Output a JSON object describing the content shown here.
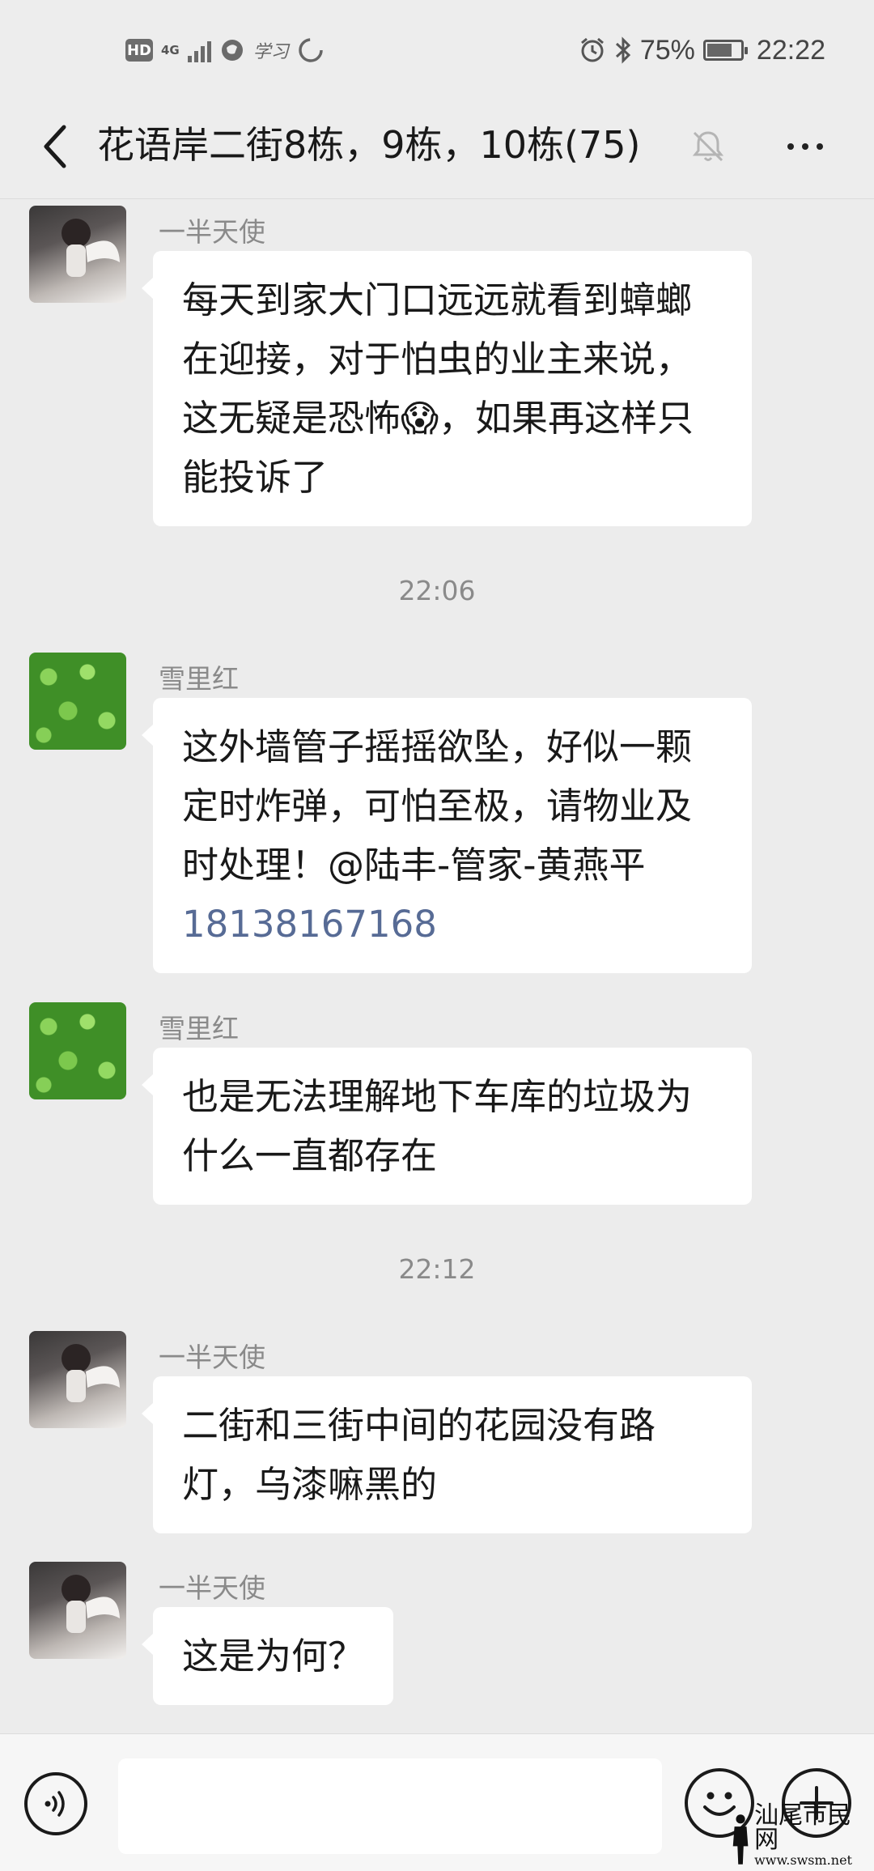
{
  "status_bar": {
    "hd": "HD",
    "network": "4G",
    "extra_icon": "学习",
    "battery": "75%",
    "battery_level": 0.75,
    "time": "22:22"
  },
  "header": {
    "title": "花语岸二街8栋，9栋，10栋(75)",
    "icons": [
      "back-icon",
      "mute-bell-icon",
      "more-icon"
    ]
  },
  "messages": [
    {
      "sender": "一半天使",
      "avatar": "angel",
      "text_before": "每天到家大门口远远就看到蟑螂在迎接，对于怕虫的业主来说，这无疑是恐怖",
      "emoji": "😱",
      "text_after": "，如果再这样只能投诉了"
    },
    {
      "timestamp": "22:06"
    },
    {
      "sender": "雪里红",
      "avatar": "green",
      "text": "这外墙管子摇摇欲坠，好似一颗定时炸弹，可怕至极，请物业及时处理！@陆丰-管家-黄燕平 ",
      "phone": "18138167168"
    },
    {
      "sender": "雪里红",
      "avatar": "green",
      "text": "也是无法理解地下车库的垃圾为什么一直都存在"
    },
    {
      "timestamp": "22:12"
    },
    {
      "sender": "一半天使",
      "avatar": "angel",
      "text": "二街和三街中间的花园没有路灯，乌漆嘛黑的"
    },
    {
      "sender": "一半天使",
      "avatar": "angel",
      "text": "这是为何？"
    }
  ],
  "input_bar": {
    "icons": [
      "voice-icon",
      "emoji-icon",
      "plus-icon"
    ],
    "value": ""
  },
  "watermark": {
    "text": "汕尾市民网",
    "url": "www.swsm.net"
  }
}
